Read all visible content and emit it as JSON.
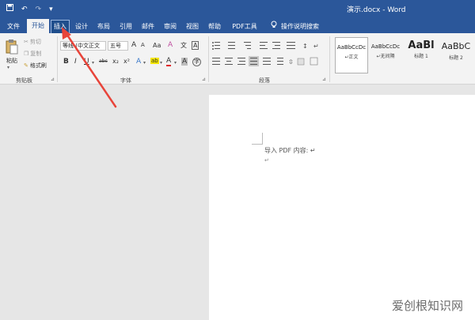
{
  "window": {
    "title": "演示.docx - Word"
  },
  "quick_access": {
    "save_icon": "save-icon",
    "undo_icon": "undo-icon",
    "redo_icon": "redo-icon",
    "more": "▾"
  },
  "tabs": [
    {
      "label": "文件"
    },
    {
      "label": "开始"
    },
    {
      "label": "插入"
    },
    {
      "label": "设计"
    },
    {
      "label": "布局"
    },
    {
      "label": "引用"
    },
    {
      "label": "邮件"
    },
    {
      "label": "审阅"
    },
    {
      "label": "视图"
    },
    {
      "label": "帮助"
    },
    {
      "label": "PDF工具集"
    },
    {
      "label": "操作说明搜索"
    }
  ],
  "clipboard": {
    "paste": "粘贴",
    "cut": "剪切",
    "copy": "复制",
    "format_painter": "格式刷",
    "group": "剪贴板"
  },
  "font": {
    "name": "等线 (中文正文",
    "size": "五号",
    "grow": "A",
    "shrink": "A",
    "case": "Aa",
    "clear": "A",
    "phonetic": "文",
    "border": "A",
    "bold": "B",
    "italic": "I",
    "underline": "U",
    "strike": "abc",
    "sub": "x₂",
    "sup": "x²",
    "effect": "A",
    "highlight": "ab",
    "color": "A",
    "shade": "A",
    "enclose": "字",
    "group": "字体"
  },
  "paragraph": {
    "group": "段落"
  },
  "styles": [
    {
      "sample": "AaBbCcDc",
      "name": "↵正文"
    },
    {
      "sample": "AaBbCcDc",
      "name": "↵无间隔"
    },
    {
      "sample": "AaBl",
      "name": "标题 1"
    },
    {
      "sample": "AaBbC",
      "name": "标题 2"
    }
  ],
  "document": {
    "line1": "导入 PDF 内容: ↵",
    "line2": "↵"
  },
  "watermark": "爱创根知识网",
  "colors": {
    "accent": "#2b579a",
    "arrow": "#e8443a"
  }
}
